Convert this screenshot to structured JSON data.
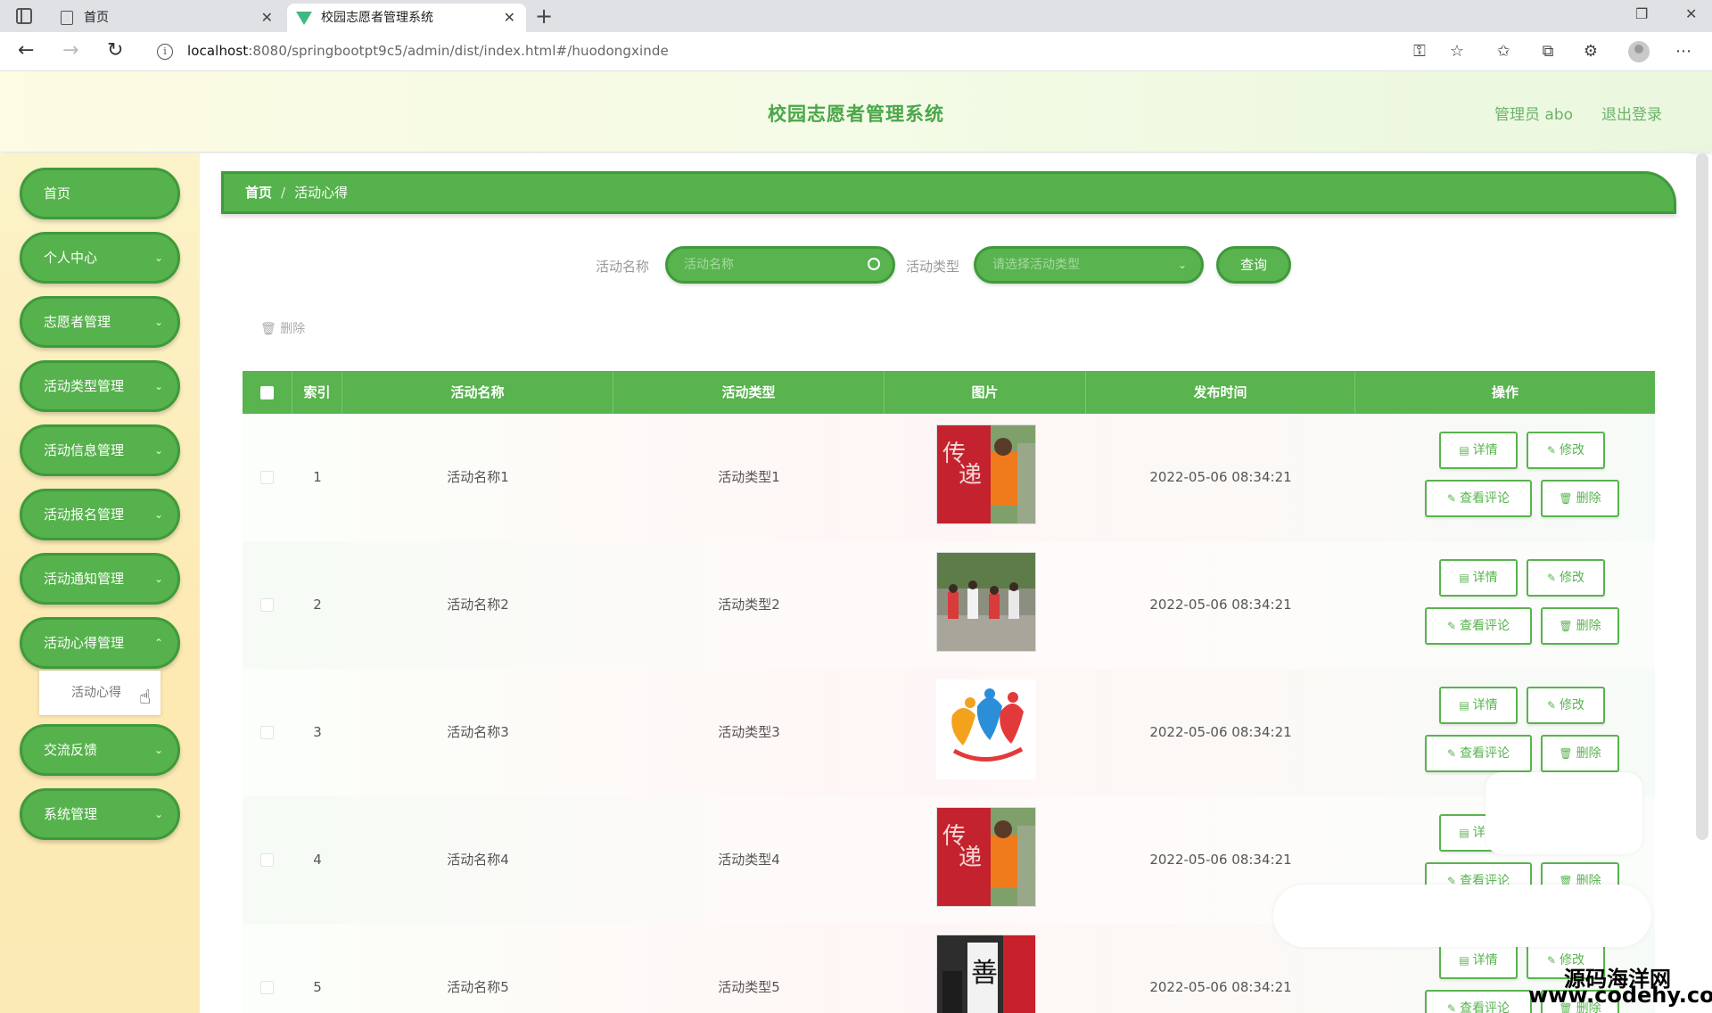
{
  "browser": {
    "tabs": [
      {
        "title": "首页"
      },
      {
        "title": "校园志愿者管理系统"
      }
    ],
    "url_host": "localhost",
    "url_path": ":8080/springbootpt9c5/admin/dist/index.html#/huodongxinde"
  },
  "header": {
    "title": "校园志愿者管理系统",
    "admin": "管理员 abo",
    "logout": "退出登录"
  },
  "sidebar": {
    "items": [
      {
        "label": "首页",
        "has_submenu": false
      },
      {
        "label": "个人中心",
        "has_submenu": true
      },
      {
        "label": "志愿者管理",
        "has_submenu": true
      },
      {
        "label": "活动类型管理",
        "has_submenu": true
      },
      {
        "label": "活动信息管理",
        "has_submenu": true
      },
      {
        "label": "活动报名管理",
        "has_submenu": true
      },
      {
        "label": "活动通知管理",
        "has_submenu": true
      },
      {
        "label": "活动心得管理",
        "has_submenu": true
      },
      {
        "label": "交流反馈",
        "has_submenu": true
      },
      {
        "label": "系统管理",
        "has_submenu": true
      }
    ],
    "submenu": {
      "label": "活动心得"
    }
  },
  "breadcrumb": {
    "home": "首页",
    "sep": "/",
    "current": "活动心得"
  },
  "search": {
    "name_label": "活动名称",
    "name_placeholder": "活动名称",
    "type_label": "活动类型",
    "type_placeholder": "请选择活动类型",
    "query_button": "查询"
  },
  "toolbar": {
    "delete_label": "删除"
  },
  "table": {
    "columns": [
      "索引",
      "活动名称",
      "活动类型",
      "图片",
      "发布时间",
      "操作"
    ],
    "rows": [
      {
        "index": "1",
        "name": "活动名称1",
        "type": "活动类型1",
        "time": "2022-05-06 08:34:21",
        "image": "volunteer-red-orange"
      },
      {
        "index": "2",
        "name": "活动名称2",
        "type": "活动类型2",
        "time": "2022-05-06 08:34:21",
        "image": "volunteers-street"
      },
      {
        "index": "3",
        "name": "活动名称3",
        "type": "活动类型3",
        "time": "2022-05-06 08:34:21",
        "image": "love-logo"
      },
      {
        "index": "4",
        "name": "活动名称4",
        "type": "活动类型4",
        "time": "2022-05-06 08:34:21",
        "image": "volunteer-red-orange"
      },
      {
        "index": "5",
        "name": "活动名称5",
        "type": "活动类型5",
        "time": "2022-05-06 08:34:21",
        "image": "calligraphy"
      }
    ],
    "actions": {
      "detail": "详情",
      "edit": "修改",
      "comments": "查看评论",
      "delete": "删除"
    }
  },
  "watermark": {
    "cn": "源码海洋网",
    "url": "www.codehy.com"
  },
  "colors": {
    "accent_green": "#59b34f",
    "border_green": "#3f9a3b",
    "title_green": "#4aa74a"
  }
}
